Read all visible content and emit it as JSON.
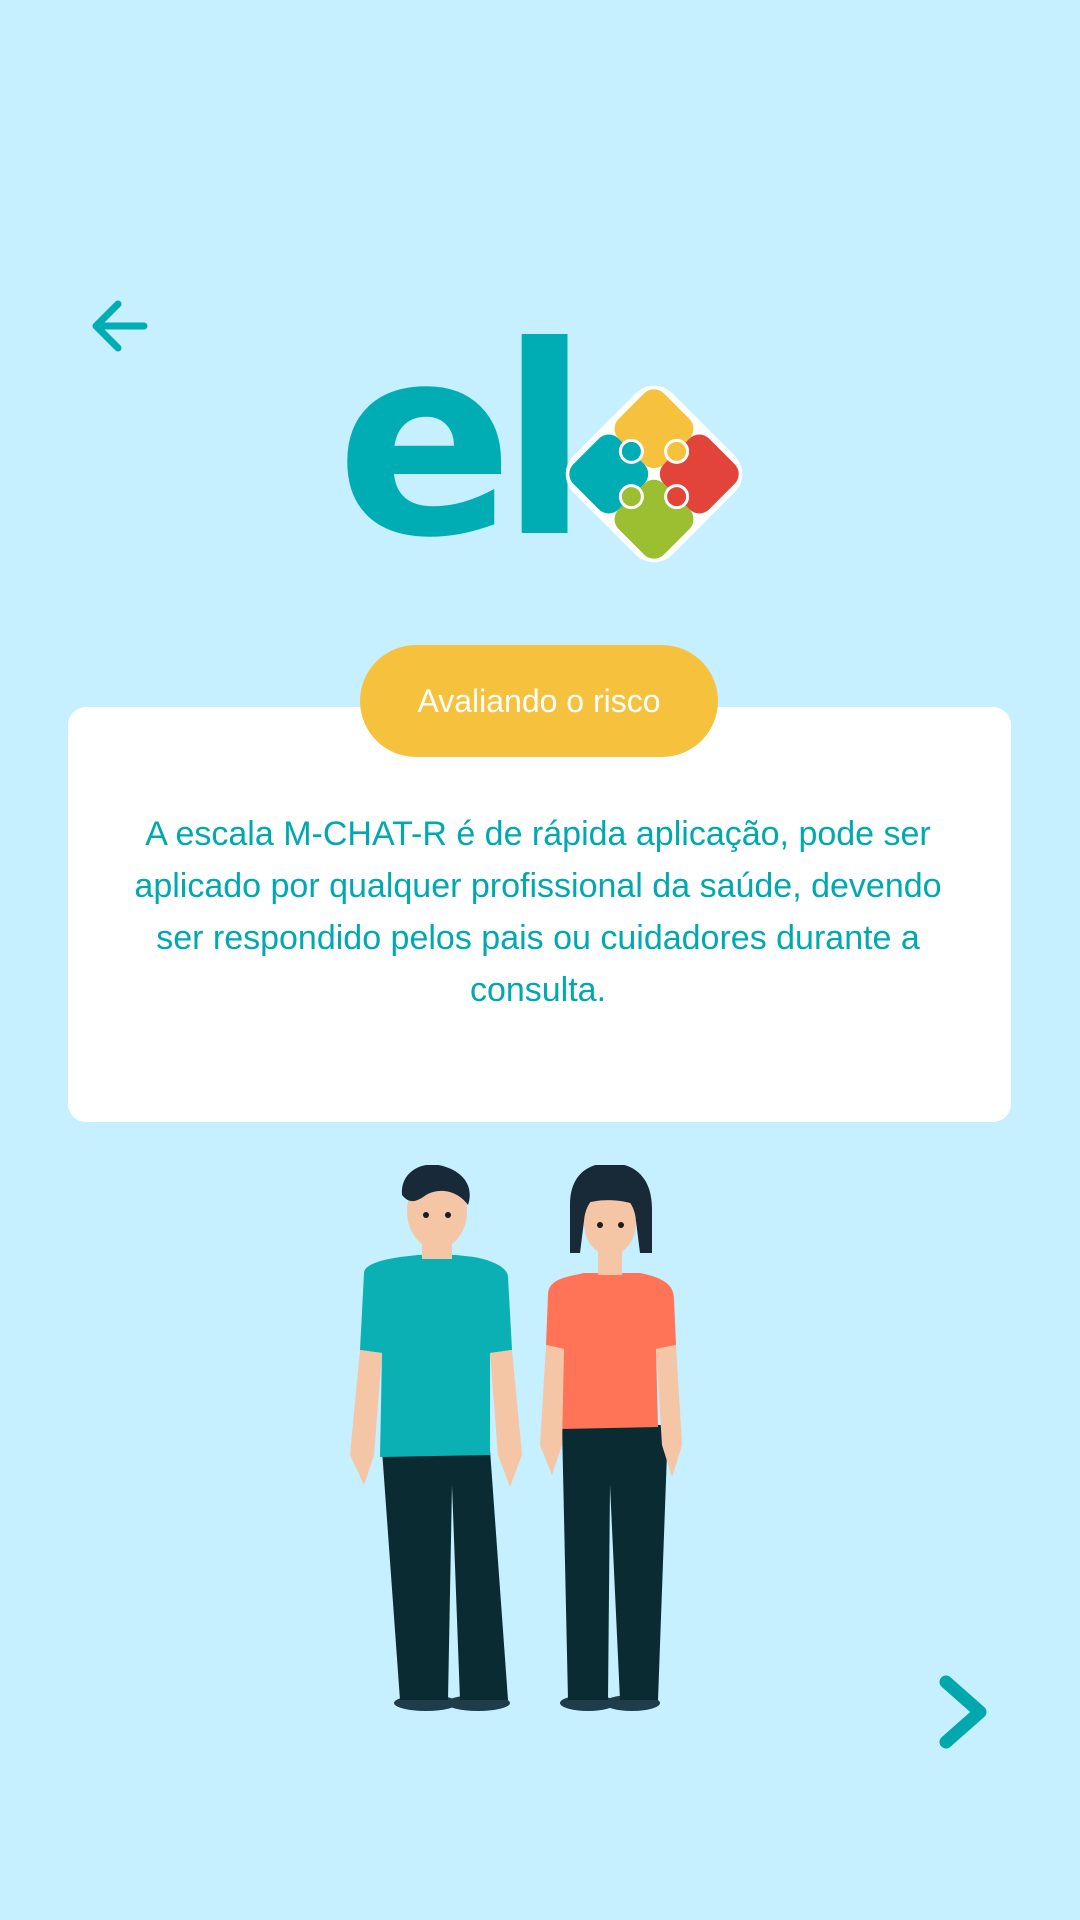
{
  "header": {
    "back_icon": "arrow-left-icon"
  },
  "logo": {
    "text": "el",
    "mark_icon": "puzzle-pieces-icon"
  },
  "card": {
    "badge_label": "Avaliando o risco",
    "body_text": "A escala M-CHAT-R é de rápida aplicação, pode ser aplicado por qualquer profissional da saúde, devendo ser respondido pelos pais ou cuidadores durante a consulta."
  },
  "navigation": {
    "next_icon": "chevron-right-icon"
  },
  "colors": {
    "background": "#c6efff",
    "accent_teal": "#00adb5",
    "badge_yellow": "#f6c23e",
    "card": "#ffffff"
  }
}
